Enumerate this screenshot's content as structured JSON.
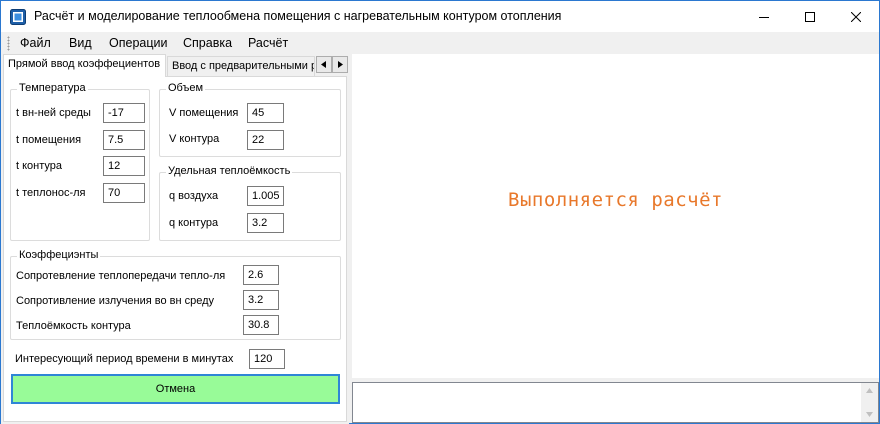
{
  "window": {
    "title": "Расчёт и моделирование теплообмена помещения с нагревательным контуром отопления"
  },
  "menu": [
    "Файл",
    "Вид",
    "Операции",
    "Справка",
    "Расчёт"
  ],
  "tabs": [
    "Прямой ввод коэффециентов",
    "Ввод с предварительными р"
  ],
  "temperature": {
    "title": "Температура",
    "rows": [
      {
        "label": "t вн-ней среды",
        "value": "-17"
      },
      {
        "label": "t помещения",
        "value": "7.5"
      },
      {
        "label": "t контура",
        "value": "12"
      },
      {
        "label": "t теплонос-ля",
        "value": "70"
      }
    ]
  },
  "volume": {
    "title": "Объем",
    "rows": [
      {
        "label": "V помещения",
        "value": "45"
      },
      {
        "label": "V контура",
        "value": "22"
      }
    ]
  },
  "heat_capacity": {
    "title": "Удельная теплоёмкость",
    "rows": [
      {
        "label": "q воздуха",
        "value": "1.005"
      },
      {
        "label": "q контура",
        "value": "3.2"
      }
    ]
  },
  "coefficients": {
    "title": "Коэффециэнты",
    "rows": [
      {
        "label": "Сопротевление теплопередачи тепло-ля",
        "value": "2.6"
      },
      {
        "label": "Сопротивление излучения во вн среду",
        "value": "3.2"
      },
      {
        "label": "Теплоёмкость контура",
        "value": "30.8"
      }
    ]
  },
  "period": {
    "label": "Интересующий период времени в минутах",
    "value": "120"
  },
  "cancel_button": "Отмена",
  "status_text": "Выполняется расчёт",
  "colors": {
    "cancel_bg": "#98fb98",
    "status_text": "#e8782b",
    "window_border": "#2b78d0"
  }
}
